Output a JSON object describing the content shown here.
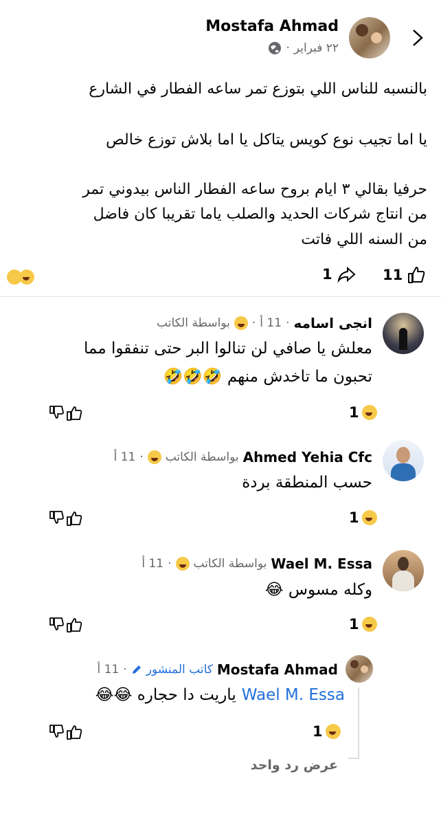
{
  "post": {
    "author": "Mostafa Ahmad",
    "date": "٢٢ فبراير",
    "lines": [
      "بالنسبه للناس اللي بتوزع تمر ساعه الفطار في الشارع",
      "يا اما تجيب نوع كويس يتاكل يا اما بلاش توزع خالص",
      "حرفيا بقالي ٣ ايام بروح ساعه الفطار الناس بيدوني تمر",
      "من انتاج شركات الحديد والصلب ياما تقريبا كان فاضل",
      "من السنه اللي فاتت"
    ],
    "likes": "11",
    "shares": "1"
  },
  "comments": [
    {
      "author": "انجى اسامه",
      "time": "11 أ",
      "badge": "بواسطة الكاتب",
      "lines": [
        "معلش يا صافي لن تنالوا البر حتى تنفقوا مما",
        "تحبون ما تاخدش منهم 🤣🤣🤣"
      ],
      "reactions": "1"
    },
    {
      "author": "Ahmed Yehia Cfc",
      "time": "11 أ",
      "badge": "بواسطة الكاتب",
      "lines": [
        "حسب المنطقة بردة"
      ],
      "reactions": "1"
    },
    {
      "author": "Wael M. Essa",
      "time": "11 أ",
      "badge": "بواسطة الكاتب",
      "lines": [
        "وكله مسوس 😂"
      ],
      "reactions": "1"
    }
  ],
  "reply": {
    "author": "Mostafa Ahmad",
    "time": "11 أ",
    "badge": "كاتب المنشور",
    "mention": "Wael M. Essa",
    "text": "ياريت دا حجاره 😂😂",
    "reactions": "1"
  },
  "view_replies": "عرض رد واحد",
  "colors": {
    "link": "#216fdb",
    "muted": "#65676b",
    "reaction": "#f7c948"
  },
  "icons": [
    "back-chevron-icon",
    "globe-icon",
    "like-icon",
    "share-icon",
    "dislike-icon",
    "pencil-icon",
    "haha-icon"
  ]
}
